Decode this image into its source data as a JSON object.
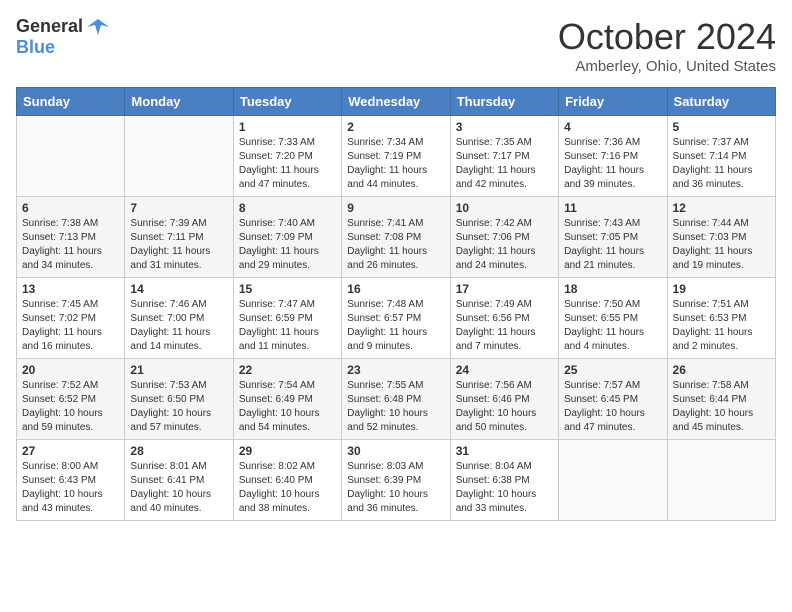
{
  "header": {
    "logo_general": "General",
    "logo_blue": "Blue",
    "title": "October 2024",
    "location": "Amberley, Ohio, United States"
  },
  "days_of_week": [
    "Sunday",
    "Monday",
    "Tuesday",
    "Wednesday",
    "Thursday",
    "Friday",
    "Saturday"
  ],
  "weeks": [
    [
      {
        "day": "",
        "sunrise": "",
        "sunset": "",
        "daylight": ""
      },
      {
        "day": "",
        "sunrise": "",
        "sunset": "",
        "daylight": ""
      },
      {
        "day": "1",
        "sunrise": "Sunrise: 7:33 AM",
        "sunset": "Sunset: 7:20 PM",
        "daylight": "Daylight: 11 hours and 47 minutes."
      },
      {
        "day": "2",
        "sunrise": "Sunrise: 7:34 AM",
        "sunset": "Sunset: 7:19 PM",
        "daylight": "Daylight: 11 hours and 44 minutes."
      },
      {
        "day": "3",
        "sunrise": "Sunrise: 7:35 AM",
        "sunset": "Sunset: 7:17 PM",
        "daylight": "Daylight: 11 hours and 42 minutes."
      },
      {
        "day": "4",
        "sunrise": "Sunrise: 7:36 AM",
        "sunset": "Sunset: 7:16 PM",
        "daylight": "Daylight: 11 hours and 39 minutes."
      },
      {
        "day": "5",
        "sunrise": "Sunrise: 7:37 AM",
        "sunset": "Sunset: 7:14 PM",
        "daylight": "Daylight: 11 hours and 36 minutes."
      }
    ],
    [
      {
        "day": "6",
        "sunrise": "Sunrise: 7:38 AM",
        "sunset": "Sunset: 7:13 PM",
        "daylight": "Daylight: 11 hours and 34 minutes."
      },
      {
        "day": "7",
        "sunrise": "Sunrise: 7:39 AM",
        "sunset": "Sunset: 7:11 PM",
        "daylight": "Daylight: 11 hours and 31 minutes."
      },
      {
        "day": "8",
        "sunrise": "Sunrise: 7:40 AM",
        "sunset": "Sunset: 7:09 PM",
        "daylight": "Daylight: 11 hours and 29 minutes."
      },
      {
        "day": "9",
        "sunrise": "Sunrise: 7:41 AM",
        "sunset": "Sunset: 7:08 PM",
        "daylight": "Daylight: 11 hours and 26 minutes."
      },
      {
        "day": "10",
        "sunrise": "Sunrise: 7:42 AM",
        "sunset": "Sunset: 7:06 PM",
        "daylight": "Daylight: 11 hours and 24 minutes."
      },
      {
        "day": "11",
        "sunrise": "Sunrise: 7:43 AM",
        "sunset": "Sunset: 7:05 PM",
        "daylight": "Daylight: 11 hours and 21 minutes."
      },
      {
        "day": "12",
        "sunrise": "Sunrise: 7:44 AM",
        "sunset": "Sunset: 7:03 PM",
        "daylight": "Daylight: 11 hours and 19 minutes."
      }
    ],
    [
      {
        "day": "13",
        "sunrise": "Sunrise: 7:45 AM",
        "sunset": "Sunset: 7:02 PM",
        "daylight": "Daylight: 11 hours and 16 minutes."
      },
      {
        "day": "14",
        "sunrise": "Sunrise: 7:46 AM",
        "sunset": "Sunset: 7:00 PM",
        "daylight": "Daylight: 11 hours and 14 minutes."
      },
      {
        "day": "15",
        "sunrise": "Sunrise: 7:47 AM",
        "sunset": "Sunset: 6:59 PM",
        "daylight": "Daylight: 11 hours and 11 minutes."
      },
      {
        "day": "16",
        "sunrise": "Sunrise: 7:48 AM",
        "sunset": "Sunset: 6:57 PM",
        "daylight": "Daylight: 11 hours and 9 minutes."
      },
      {
        "day": "17",
        "sunrise": "Sunrise: 7:49 AM",
        "sunset": "Sunset: 6:56 PM",
        "daylight": "Daylight: 11 hours and 7 minutes."
      },
      {
        "day": "18",
        "sunrise": "Sunrise: 7:50 AM",
        "sunset": "Sunset: 6:55 PM",
        "daylight": "Daylight: 11 hours and 4 minutes."
      },
      {
        "day": "19",
        "sunrise": "Sunrise: 7:51 AM",
        "sunset": "Sunset: 6:53 PM",
        "daylight": "Daylight: 11 hours and 2 minutes."
      }
    ],
    [
      {
        "day": "20",
        "sunrise": "Sunrise: 7:52 AM",
        "sunset": "Sunset: 6:52 PM",
        "daylight": "Daylight: 10 hours and 59 minutes."
      },
      {
        "day": "21",
        "sunrise": "Sunrise: 7:53 AM",
        "sunset": "Sunset: 6:50 PM",
        "daylight": "Daylight: 10 hours and 57 minutes."
      },
      {
        "day": "22",
        "sunrise": "Sunrise: 7:54 AM",
        "sunset": "Sunset: 6:49 PM",
        "daylight": "Daylight: 10 hours and 54 minutes."
      },
      {
        "day": "23",
        "sunrise": "Sunrise: 7:55 AM",
        "sunset": "Sunset: 6:48 PM",
        "daylight": "Daylight: 10 hours and 52 minutes."
      },
      {
        "day": "24",
        "sunrise": "Sunrise: 7:56 AM",
        "sunset": "Sunset: 6:46 PM",
        "daylight": "Daylight: 10 hours and 50 minutes."
      },
      {
        "day": "25",
        "sunrise": "Sunrise: 7:57 AM",
        "sunset": "Sunset: 6:45 PM",
        "daylight": "Daylight: 10 hours and 47 minutes."
      },
      {
        "day": "26",
        "sunrise": "Sunrise: 7:58 AM",
        "sunset": "Sunset: 6:44 PM",
        "daylight": "Daylight: 10 hours and 45 minutes."
      }
    ],
    [
      {
        "day": "27",
        "sunrise": "Sunrise: 8:00 AM",
        "sunset": "Sunset: 6:43 PM",
        "daylight": "Daylight: 10 hours and 43 minutes."
      },
      {
        "day": "28",
        "sunrise": "Sunrise: 8:01 AM",
        "sunset": "Sunset: 6:41 PM",
        "daylight": "Daylight: 10 hours and 40 minutes."
      },
      {
        "day": "29",
        "sunrise": "Sunrise: 8:02 AM",
        "sunset": "Sunset: 6:40 PM",
        "daylight": "Daylight: 10 hours and 38 minutes."
      },
      {
        "day": "30",
        "sunrise": "Sunrise: 8:03 AM",
        "sunset": "Sunset: 6:39 PM",
        "daylight": "Daylight: 10 hours and 36 minutes."
      },
      {
        "day": "31",
        "sunrise": "Sunrise: 8:04 AM",
        "sunset": "Sunset: 6:38 PM",
        "daylight": "Daylight: 10 hours and 33 minutes."
      },
      {
        "day": "",
        "sunrise": "",
        "sunset": "",
        "daylight": ""
      },
      {
        "day": "",
        "sunrise": "",
        "sunset": "",
        "daylight": ""
      }
    ]
  ]
}
